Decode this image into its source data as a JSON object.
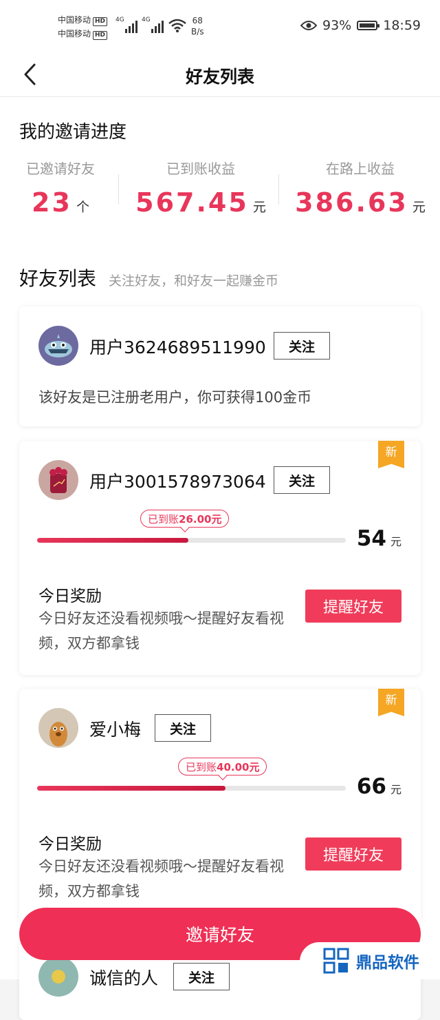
{
  "status_bar": {
    "carrier_1": "中国移动",
    "carrier_2": "中国移动",
    "hd": "HD",
    "net_1": "4G",
    "net_2": "4G",
    "speed_value": "68",
    "speed_unit": "B/s",
    "battery_percent": "93%",
    "time": "18:59",
    "battery_level": 0.93
  },
  "header": {
    "title": "好友列表"
  },
  "progress": {
    "title": "我的邀请进度",
    "invited_label": "已邀请好友",
    "invited_value": "23",
    "invited_unit": "个",
    "received_label": "已到账收益",
    "received_value": "567.45",
    "received_unit": "元",
    "pending_label": "在路上收益",
    "pending_value": "386.63",
    "pending_unit": "元"
  },
  "friend_list": {
    "title": "好友列表",
    "subtitle": "关注好友，和好友一起赚金币",
    "follow_label": "关注",
    "new_label": "新",
    "friends": [
      {
        "name": "用户3624689511990",
        "note": "该好友是已注册老用户，你可获得100金币"
      },
      {
        "name": "用户3001578973064",
        "bubble_prefix": "已到账",
        "bubble_amount": "26.00元",
        "progress": 0.49,
        "amount": "54",
        "amount_unit": "元",
        "reward_title": "今日奖励",
        "reward_desc": "今日好友还没看视频哦～提醒好友看视频，双方都拿钱",
        "remind_label": "提醒好友"
      },
      {
        "name": "爱小梅",
        "bubble_prefix": "已到账",
        "bubble_amount": "40.00元",
        "progress": 0.61,
        "amount": "66",
        "amount_unit": "元",
        "reward_title": "今日奖励",
        "reward_desc": "今日好友还没看视频哦～提醒好友看视频，双方都拿钱",
        "remind_label": "提醒好友"
      },
      {
        "name": "诚信的人"
      }
    ]
  },
  "invite_button": "邀请好友",
  "watermark": "鼎品软件",
  "colors": {
    "accent": "#ef2f55",
    "badge": "#f5a623",
    "brand_blue": "#1565c0"
  },
  "icons": {
    "back": "chevron-left-icon",
    "eye": "eye-icon",
    "wifi": "wifi-icon",
    "battery": "battery-icon"
  }
}
